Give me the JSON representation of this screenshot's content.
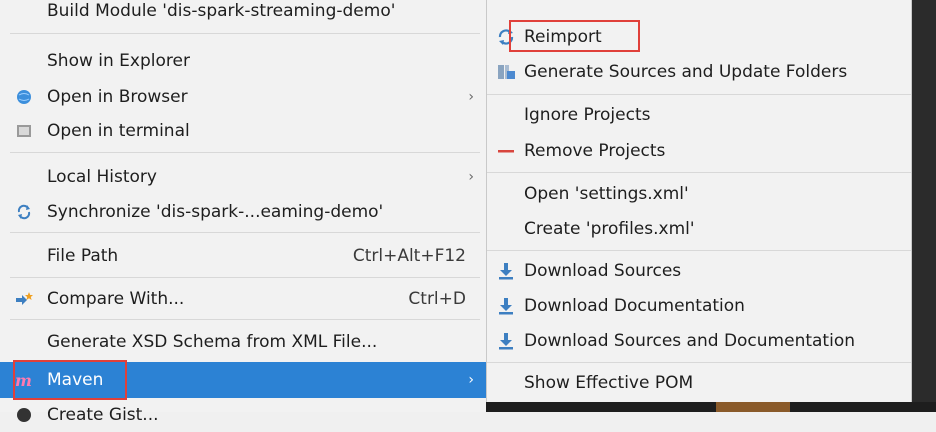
{
  "left_menu": {
    "items": [
      {
        "label": "Build Module 'dis-spark-streaming-demo'",
        "icon": "none"
      },
      {
        "label": "Show in Explorer",
        "icon": "none"
      },
      {
        "label": "Open in Browser",
        "icon": "globe-icon",
        "submenu": true
      },
      {
        "label": "Open in terminal",
        "icon": "terminal-icon"
      },
      {
        "label": "Local History",
        "icon": "none",
        "submenu": true
      },
      {
        "label": "Synchronize 'dis-spark-...eaming-demo'",
        "icon": "sync-icon"
      },
      {
        "label": "File Path",
        "icon": "none",
        "shortcut": "Ctrl+Alt+F12"
      },
      {
        "label": "Compare With...",
        "icon": "compare-icon",
        "shortcut": "Ctrl+D"
      },
      {
        "label": "Generate XSD Schema from XML File...",
        "icon": "none"
      },
      {
        "label": "Maven",
        "icon": "maven-icon",
        "submenu": true,
        "selected": true
      },
      {
        "label": "Create Gist...",
        "icon": "github-icon"
      }
    ]
  },
  "right_menu": {
    "items": [
      {
        "label": "Reimport",
        "icon": "reimport-icon"
      },
      {
        "label": "Generate Sources and Update Folders",
        "icon": "generate-sources-icon"
      },
      {
        "label": "Ignore Projects",
        "icon": "none"
      },
      {
        "label": "Remove Projects",
        "icon": "remove-icon"
      },
      {
        "label": "Open 'settings.xml'",
        "icon": "none"
      },
      {
        "label": "Create 'profiles.xml'",
        "icon": "none"
      },
      {
        "label": "Download Sources",
        "icon": "download-icon"
      },
      {
        "label": "Download Documentation",
        "icon": "download-icon"
      },
      {
        "label": "Download Sources and Documentation",
        "icon": "download-icon"
      },
      {
        "label": "Show Effective POM",
        "icon": "none"
      }
    ]
  },
  "colors": {
    "selection": "#2c82d4",
    "highlight_box": "#e0403a",
    "menu_bg": "#f2f2f2"
  }
}
